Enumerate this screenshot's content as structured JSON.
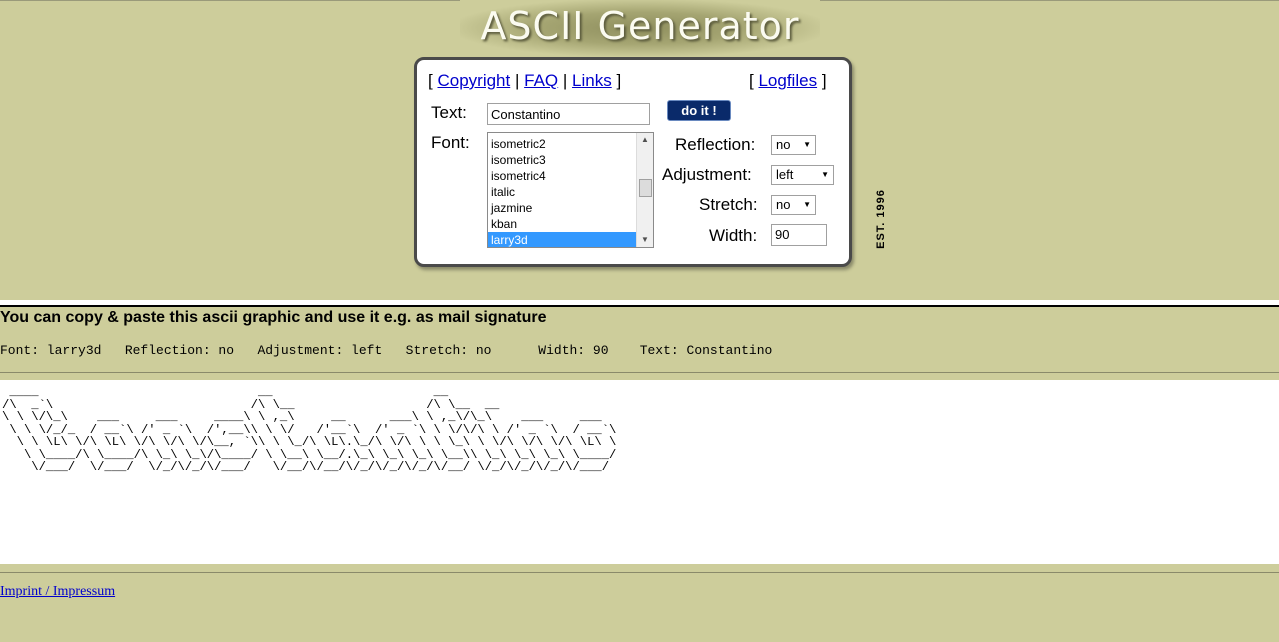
{
  "header": {
    "title": "ASCII Generator",
    "est": "EST. 1996"
  },
  "nav": {
    "open": "[",
    "sep1": "|",
    "sep2": "|",
    "close": "]",
    "copyright": "Copyright",
    "faq": "FAQ",
    "links": "Links",
    "logfiles": "Logfiles"
  },
  "form": {
    "text_label": "Text:",
    "text_value": "Constantino",
    "do_it": "do it !",
    "font_label": "Font:",
    "fonts": [
      "isometric2",
      "isometric3",
      "isometric4",
      "italic",
      "jazmine",
      "kban",
      "larry3d"
    ],
    "selected_font": "larry3d",
    "reflection_label": "Reflection:",
    "reflection_value": "no",
    "adjustment_label": "Adjustment:",
    "adjustment_value": "left",
    "stretch_label": "Stretch:",
    "stretch_value": "no",
    "width_label": "Width:",
    "width_value": "90"
  },
  "result": {
    "copy_info": "You can copy & paste this ascii graphic and use it e.g. as mail signature",
    "settings_line": "Font: larry3d   Reflection: no   Adjustment: left   Stretch: no      Width: 90    Text: Constantino",
    "ascii_art": " ____                              __                      __\n/\\  _`\\                           /\\ \\__                  /\\ \\__  __\n\\ \\ \\/\\_\\    ___     ___     ____\\ \\ ,_\\     __      ___\\ \\ ,_\\/\\_\\    ___     ___\n \\ \\ \\/_/_  / __`\\ /' _ `\\  /',__\\\\ \\ \\/   /'__`\\  /' _ `\\ \\ \\/\\/\\ \\ /' _ `\\  / __`\\\n  \\ \\ \\L\\ \\/\\ \\L\\ \\/\\ \\/\\ \\/\\__, `\\\\ \\ \\_/\\ \\L\\.\\_/\\ \\/\\ \\ \\ \\_\\ \\ \\/\\ \\/\\ \\/\\ \\L\\ \\\n   \\ \\____/\\ \\____/\\ \\_\\ \\_\\/\\____/ \\ \\__\\ \\__/.\\_\\ \\_\\ \\_\\ \\__\\\\ \\_\\ \\_\\ \\_\\ \\____/\n    \\/___/  \\/___/  \\/_/\\/_/\\/___/   \\/__/\\/__/\\/_/\\/_/\\/_/\\/__/ \\/_/\\/_/\\/_/\\/___/"
  },
  "footer": {
    "imprint": "Imprint / Impressum"
  }
}
